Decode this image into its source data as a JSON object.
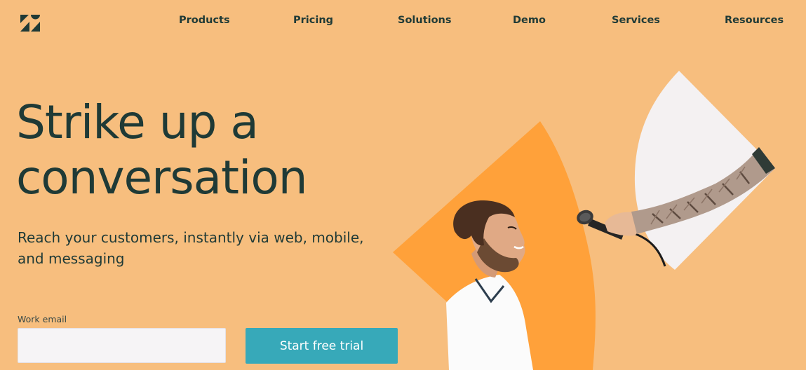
{
  "nav": {
    "items": [
      {
        "label": "Products"
      },
      {
        "label": "Pricing"
      },
      {
        "label": "Solutions"
      },
      {
        "label": "Demo"
      },
      {
        "label": "Services"
      },
      {
        "label": "Resources"
      }
    ]
  },
  "hero": {
    "headline_line1": "Strike up a",
    "headline_line2": "conversation",
    "subhead_line1": "Reach your customers, instantly via web, mobile,",
    "subhead_line2": "and messaging"
  },
  "form": {
    "email_label": "Work email",
    "email_value": "",
    "cta_label": "Start free trial"
  },
  "colors": {
    "background": "#F7BE7E",
    "accent_orange": "#FFA13A",
    "text_dark": "#1F3A36",
    "cta": "#37A9B9"
  },
  "icons": {
    "logo": "zendesk-logo-icon"
  }
}
